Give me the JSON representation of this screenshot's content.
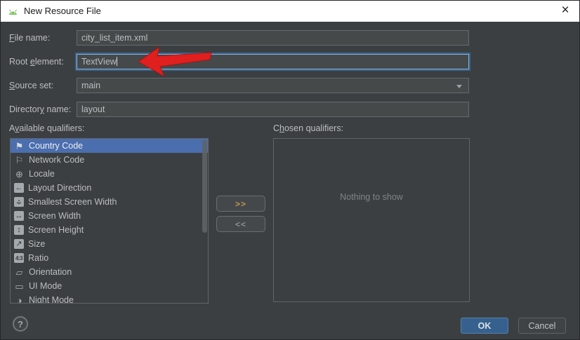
{
  "window": {
    "title": "New Resource File",
    "close_glyph": "×"
  },
  "form": {
    "file_name": {
      "label_pre": "",
      "label_mn": "F",
      "label_post": "ile name:",
      "value": "city_list_item.xml"
    },
    "root_element": {
      "label_pre": "Root ",
      "label_mn": "e",
      "label_post": "lement:",
      "value": "TextView"
    },
    "source_set": {
      "label_pre": "",
      "label_mn": "S",
      "label_post": "ource set:",
      "value": "main"
    },
    "directory_name": {
      "label_pre": "Director",
      "label_mn": "y",
      "label_post": " name:",
      "value": "layout"
    }
  },
  "qualifiers": {
    "available_label_pre": "A",
    "available_label_mn": "v",
    "available_label_post": "ailable qualifiers:",
    "chosen_label_pre": "C",
    "chosen_label_mn": "h",
    "chosen_label_post": "osen qualifiers:",
    "empty_text": "Nothing to show",
    "move_right_label": ">>",
    "move_left_label": "<<",
    "items": [
      {
        "label": "Country Code",
        "icon": "flag-globe-icon",
        "glyph": "⚑",
        "selected": true
      },
      {
        "label": "Network Code",
        "icon": "flag-signal-icon",
        "glyph": "⚐"
      },
      {
        "label": "Locale",
        "icon": "globe-icon",
        "glyph": "⊕"
      },
      {
        "label": "Layout Direction",
        "icon": "left-arrow-icon",
        "glyph": "←"
      },
      {
        "label": "Smallest Screen Width",
        "icon": "expand-arrows-icon",
        "glyph": "↔",
        "glyph2": "↕"
      },
      {
        "label": "Screen Width",
        "icon": "width-arrow-icon",
        "glyph": "↔"
      },
      {
        "label": "Screen Height",
        "icon": "height-arrow-icon",
        "glyph": "↕"
      },
      {
        "label": "Size",
        "icon": "diagonal-arrow-icon",
        "glyph": "↗"
      },
      {
        "label": "Ratio",
        "icon": "ratio-icon",
        "glyph": "4:3"
      },
      {
        "label": "Orientation",
        "icon": "orientation-icon",
        "glyph": "▱"
      },
      {
        "label": "UI Mode",
        "icon": "ui-mode-icon",
        "glyph": "▭"
      },
      {
        "label": "Night Mode",
        "icon": "night-mode-icon",
        "glyph": "◑"
      }
    ]
  },
  "footer": {
    "help_label": "?",
    "ok_label": "OK",
    "cancel_label": "Cancel"
  },
  "colors": {
    "titlebar_bg": "#ffffff",
    "body_bg": "#3c3f41",
    "selection_blue": "#4b6eaf",
    "focus_border_blue": "#3a648f",
    "ok_button_bg": "#36618e",
    "annotation_arrow_red": "#e01f1f",
    "move_right_chevrons": "#c49454"
  }
}
